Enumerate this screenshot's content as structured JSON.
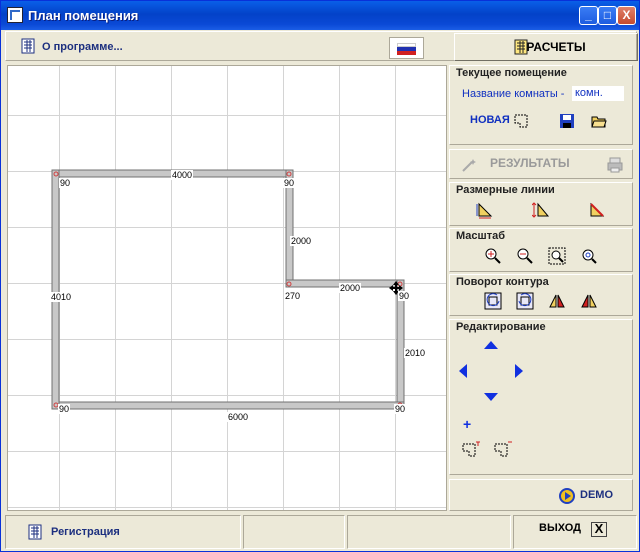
{
  "window": {
    "title": "План помещения"
  },
  "titlebar_buttons": {
    "minimize": "_",
    "maximize": "□",
    "close": "X"
  },
  "toolbar": {
    "about_label": "О программе...",
    "calc_label": "РАСЧЕТЫ"
  },
  "current_room": {
    "header": "Текущее помещение",
    "name_label": "Название комнаты -",
    "name_value": "комн.",
    "new_label": "НОВАЯ"
  },
  "results": {
    "label": "РЕЗУЛЬТАТЫ"
  },
  "dimension_lines": {
    "header": "Размерные линии"
  },
  "scale": {
    "header": "Масштаб"
  },
  "rotate": {
    "header": "Поворот контура"
  },
  "edit": {
    "header": "Редактирование",
    "plus": "+"
  },
  "demo": {
    "label": "DEMO"
  },
  "status": {
    "register_label": "Регистрация",
    "exit_label": "ВЫХОД",
    "exit_x": "X"
  },
  "plan": {
    "edges": [
      {
        "length": "4000"
      },
      {
        "length": "2000"
      },
      {
        "length": "2000"
      },
      {
        "length": "2010"
      },
      {
        "length": "6000"
      },
      {
        "length": "4010"
      }
    ],
    "corners": [
      {
        "angle": "90"
      },
      {
        "angle": "90"
      },
      {
        "angle": "270"
      },
      {
        "angle": "90"
      },
      {
        "angle": "90"
      },
      {
        "angle": "90"
      }
    ]
  },
  "colors": {
    "wall": "#c8c8c8",
    "accent_blue": "#1030c0",
    "vertex": "#d04040"
  }
}
